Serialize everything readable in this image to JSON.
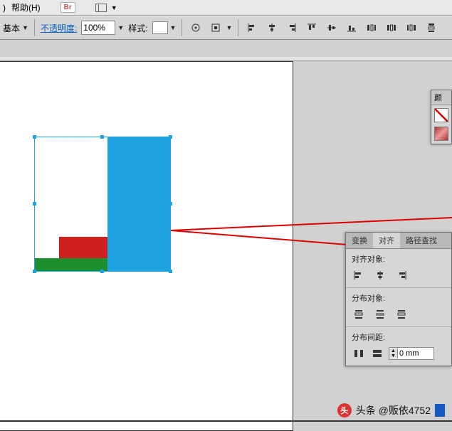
{
  "menubar": {
    "menu1_suffix": ")",
    "help_label": "帮助(H)",
    "br_label": "Br"
  },
  "optionsbar": {
    "basic_label": "基本",
    "opacity_label": "不透明度:",
    "opacity_value": "100%",
    "style_label": "样式:"
  },
  "color_panel": {
    "title": "颜"
  },
  "align_panel": {
    "tab_transform": "变换",
    "tab_align": "对齐",
    "tab_pathfinder": "路径查找",
    "sec_align": "对齐对象:",
    "sec_distribute": "分布对象:",
    "sec_spacing": "分布间距:",
    "spacing_value": "0 mm"
  },
  "watermark": {
    "text": "头条 @贩依4752"
  }
}
